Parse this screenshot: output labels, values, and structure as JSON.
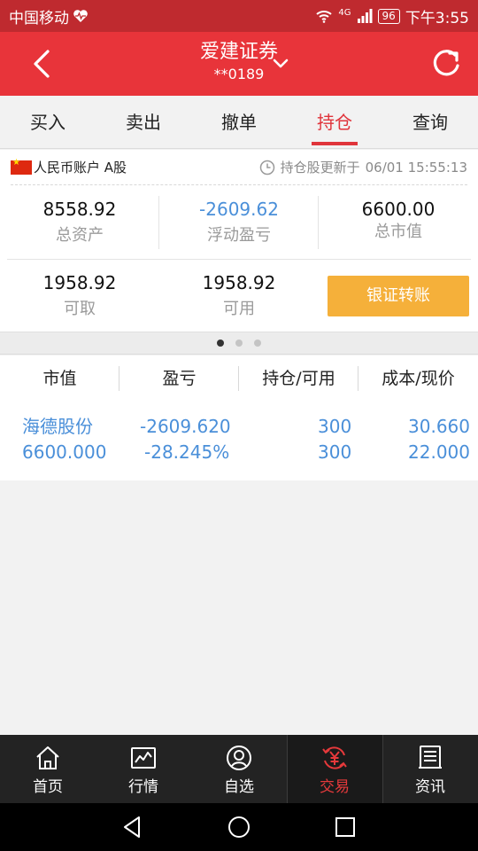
{
  "status_bar": {
    "carrier": "中国移动",
    "network": "4G",
    "battery": "96",
    "time": "下午3:55"
  },
  "header": {
    "title": "爱建证券",
    "account": "**0189"
  },
  "tabs": [
    {
      "label": "买入"
    },
    {
      "label": "卖出"
    },
    {
      "label": "撤单"
    },
    {
      "label": "持仓",
      "active": true
    },
    {
      "label": "查询"
    }
  ],
  "account": {
    "name": "人民币账户 A股",
    "updated_label": "持仓股更新于",
    "updated_time": "06/01 15:55:13",
    "total_assets": {
      "value": "8558.92",
      "label": "总资产"
    },
    "floating_pnl": {
      "value": "-2609.62",
      "label": "浮动盈亏"
    },
    "market_value": {
      "value": "6600.00",
      "label": "总市值"
    },
    "withdrawable": {
      "value": "1958.92",
      "label": "可取"
    },
    "available": {
      "value": "1958.92",
      "label": "可用"
    },
    "transfer_button": "银证转账"
  },
  "pager": {
    "pages": 3,
    "current": 1
  },
  "holdings": {
    "headers": [
      "市值",
      "盈亏",
      "持仓/可用",
      "成本/现价"
    ],
    "rows": [
      {
        "name": "海德股份",
        "market_value": "6600.000",
        "pnl": "-2609.620",
        "pnl_pct": "-28.245%",
        "position": "300",
        "available": "300",
        "cost": "30.660",
        "price": "22.000"
      }
    ]
  },
  "bottom_nav": [
    {
      "label": "首页",
      "icon": "home-icon"
    },
    {
      "label": "行情",
      "icon": "chart-icon"
    },
    {
      "label": "自选",
      "icon": "user-circle-icon"
    },
    {
      "label": "交易",
      "icon": "yuan-exchange-icon",
      "active": true
    },
    {
      "label": "资讯",
      "icon": "news-icon"
    }
  ],
  "colors": {
    "header": "#e8343a",
    "status_bar": "#bf2a2f",
    "accent_red": "#e0343b",
    "accent_blue": "#4a8fd9",
    "button_orange": "#f5b03a"
  }
}
